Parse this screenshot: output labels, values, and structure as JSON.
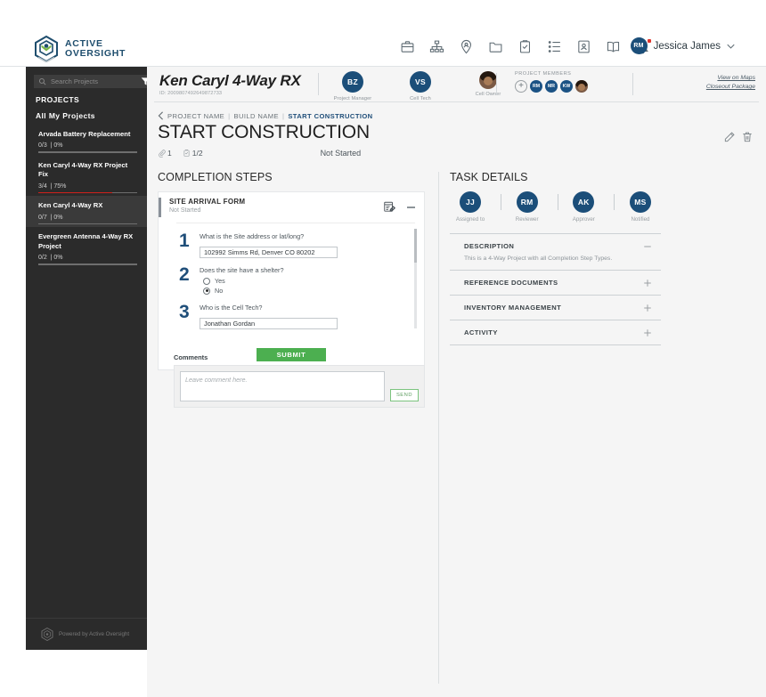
{
  "brand": {
    "line1": "ACTIVE",
    "line2": "OVERSIGHT",
    "logo_icon": "hexagon-shield-logo"
  },
  "topnav": {
    "icons": [
      {
        "name": "briefcase-icon",
        "label": "Briefcase"
      },
      {
        "name": "org-chart-icon",
        "label": "Org Chart"
      },
      {
        "name": "map-pin-person-icon",
        "label": "Site Locator"
      },
      {
        "name": "folder-icon",
        "label": "Folders"
      },
      {
        "name": "clipboard-check-icon",
        "label": "Tasks"
      },
      {
        "name": "list-icon",
        "label": "Lists"
      },
      {
        "name": "contact-card-icon",
        "label": "Contacts"
      },
      {
        "name": "book-icon",
        "label": "Library"
      },
      {
        "name": "bell-icon",
        "label": "Notifications",
        "badge": true
      }
    ],
    "user": {
      "initials": "RM",
      "name": "Jessica James",
      "caret_icon": "chevron-down-icon"
    }
  },
  "sidebar": {
    "search": {
      "placeholder": "Search Projects",
      "value": "",
      "icon": "search-icon"
    },
    "filter": {
      "icon": "filter-icon",
      "has_badge": true
    },
    "heading": "PROJECTS",
    "subheading": "All My Projects",
    "projects": [
      {
        "name": "Arvada Battery Replacement",
        "count": "0/3",
        "percent": "0%",
        "progress": 0,
        "active": false
      },
      {
        "name": "Ken Caryl 4-Way RX Project Fix",
        "count": "3/4",
        "percent": "75%",
        "progress": 75,
        "active": false
      },
      {
        "name": "Ken Caryl 4-Way RX",
        "count": "0/7",
        "percent": "0%",
        "progress": 0,
        "active": true
      },
      {
        "name": "Evergreen Antenna 4-Way RX Project",
        "count": "0/2",
        "percent": "0%",
        "progress": 0,
        "active": false
      }
    ],
    "footer": {
      "text": "Powered by Active Oversight",
      "icon": "hexagon-logo-icon"
    }
  },
  "project_header": {
    "name": "Ken Caryl 4-Way RX",
    "id": "ID: 2009807492649872733",
    "roles": [
      {
        "initials": "BZ",
        "label": "Project Manager",
        "type": "initials"
      },
      {
        "initials": "VS",
        "label": "Cell Tech",
        "type": "initials"
      },
      {
        "initials": "",
        "label": "Cell Owner",
        "type": "photo"
      }
    ],
    "members_label": "PROJECT MEMBERS",
    "members": [
      {
        "initials": "RM",
        "type": "initials"
      },
      {
        "initials": "MR",
        "type": "initials"
      },
      {
        "initials": "KW",
        "type": "initials"
      },
      {
        "initials": "",
        "type": "photo"
      }
    ],
    "add_member_icon": "plus-circle-icon",
    "links": [
      "View on Maps",
      "Closeout Package"
    ]
  },
  "breadcrumb": {
    "back_icon": "chevron-left-icon",
    "items": [
      "PROJECT NAME",
      "BUILD NAME",
      "START CONSTRUCTION"
    ],
    "separator": "|"
  },
  "page": {
    "title": "START CONSTRUCTION",
    "attachments_icon": "paperclip-icon",
    "attachments_count": "1",
    "checklist_icon": "clipboard-check-icon",
    "checklist_count": "1/2",
    "status": "Not Started",
    "edit_icon": "pencil-icon",
    "delete_icon": "trash-icon"
  },
  "completion_steps": {
    "heading": "COMPLETION STEPS",
    "step": {
      "name": "SITE ARRIVAL FORM",
      "status": "Not Started",
      "form_icon": "form-edit-icon",
      "collapse_icon": "minus-icon",
      "questions": [
        {
          "number": "1",
          "label": "What is the Site address or lat/long?",
          "type": "text",
          "value": "102992 Simms Rd, Denver CO 80202"
        },
        {
          "number": "2",
          "label": "Does the site have a shelter?",
          "type": "radio",
          "options": [
            {
              "label": "Yes",
              "selected": false
            },
            {
              "label": "No",
              "selected": true
            }
          ]
        },
        {
          "number": "3",
          "label": "Who is the Cell Tech?",
          "type": "text",
          "value": "Jonathan Gordan"
        }
      ],
      "submit_label": "SUBMIT"
    }
  },
  "comments": {
    "label": "Comments",
    "placeholder": "Leave comment here.",
    "value": "",
    "send_label": "SEND"
  },
  "task_details": {
    "heading": "TASK DETAILS",
    "people": [
      {
        "initials": "JJ",
        "role": "Assigned to"
      },
      {
        "initials": "RM",
        "role": "Reviewer"
      },
      {
        "initials": "AK",
        "role": "Approver"
      },
      {
        "initials": "MS",
        "role": "Notified"
      }
    ],
    "sections": [
      {
        "title": "DESCRIPTION",
        "expanded": true,
        "toggle_icon": "minus-icon",
        "body": "This is a 4-Way Project with all Completion Step Types."
      },
      {
        "title": "REFERENCE DOCUMENTS",
        "expanded": false,
        "toggle_icon": "plus-icon",
        "body": ""
      },
      {
        "title": "INVENTORY MANAGEMENT",
        "expanded": false,
        "toggle_icon": "plus-icon",
        "body": ""
      },
      {
        "title": "ACTIVITY",
        "expanded": false,
        "toggle_icon": "plus-icon",
        "body": ""
      }
    ]
  },
  "colors": {
    "brand_blue": "#1f4e6e",
    "accent_blue": "#1b4e79",
    "sidebar_bg": "#2b2b2b",
    "progress_red": "#d0211c",
    "submit_green": "#4caf50",
    "canvas_bg": "#f5f5f5"
  }
}
